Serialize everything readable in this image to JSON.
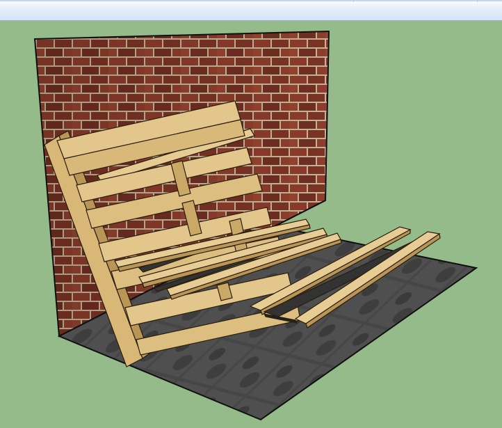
{
  "window": {
    "toolbar_label": "",
    "background_color": "#95bb8a"
  },
  "model": {
    "objects": [
      {
        "icon": "brick-wall-icon"
      },
      {
        "icon": "stone-floor-icon"
      },
      {
        "icon": "pallet-back-icon"
      },
      {
        "icon": "pallet-seat-icon"
      },
      {
        "icon": "loose-planks-icon"
      }
    ]
  },
  "colors": {
    "wood": "#e0c48a",
    "wood_light": "#f0d9a6",
    "wood_dark": "#b99556",
    "brick": "#8a3e2c",
    "mortar": "#c9b9a0",
    "floor": "#4e4e4e",
    "floor_dark": "#2f2f2f",
    "outline": "#111111"
  }
}
